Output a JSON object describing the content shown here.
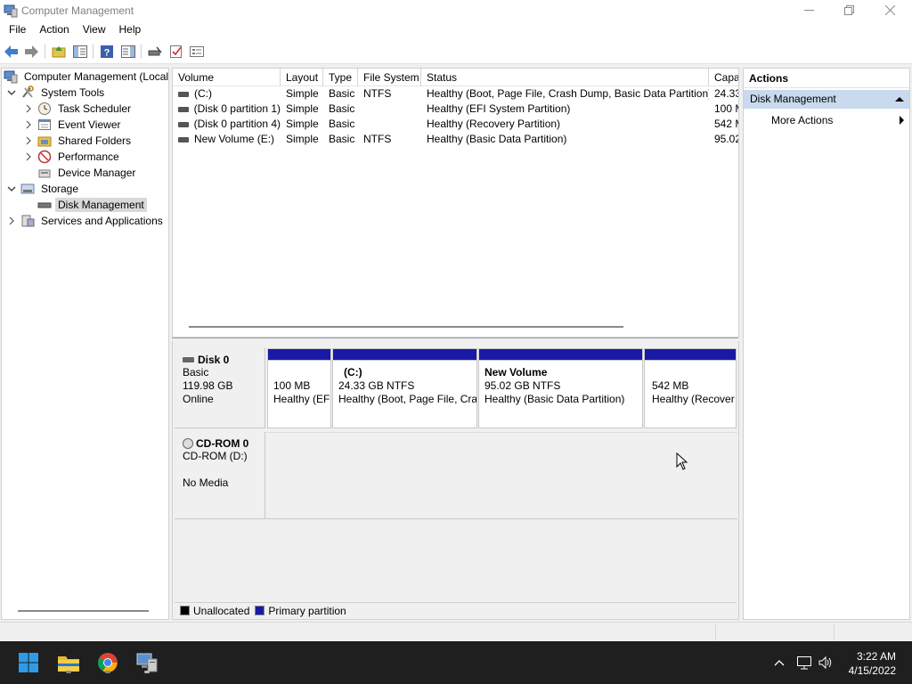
{
  "window": {
    "title": "Computer Management"
  },
  "menu": [
    "File",
    "Action",
    "View",
    "Help"
  ],
  "tree": {
    "root": "Computer Management (Local",
    "system_tools": "System Tools",
    "task_scheduler": "Task Scheduler",
    "event_viewer": "Event Viewer",
    "shared_folders": "Shared Folders",
    "performance": "Performance",
    "device_manager": "Device Manager",
    "storage": "Storage",
    "disk_management": "Disk Management",
    "services": "Services and Applications"
  },
  "volumes": {
    "columns": [
      "Volume",
      "Layout",
      "Type",
      "File System",
      "Status",
      "Capa"
    ],
    "rows": [
      {
        "volume": " (C:)",
        "layout": "Simple",
        "type": "Basic",
        "fs": "NTFS",
        "status": "Healthy (Boot, Page File, Crash Dump, Basic Data Partition)",
        "capacity": "24.33"
      },
      {
        "volume": "(Disk 0 partition 1)",
        "layout": "Simple",
        "type": "Basic",
        "fs": "",
        "status": "Healthy (EFI System Partition)",
        "capacity": "100 M"
      },
      {
        "volume": "(Disk 0 partition 4)",
        "layout": "Simple",
        "type": "Basic",
        "fs": "",
        "status": "Healthy (Recovery Partition)",
        "capacity": "542 M"
      },
      {
        "volume": "New Volume (E:)",
        "layout": "Simple",
        "type": "Basic",
        "fs": "NTFS",
        "status": "Healthy (Basic Data Partition)",
        "capacity": "95.02"
      }
    ]
  },
  "disk0": {
    "name": "Disk 0",
    "type": "Basic",
    "size": "119.98 GB",
    "state": "Online",
    "partitions": [
      {
        "title": "",
        "size": "100 MB",
        "status": "Healthy (EF"
      },
      {
        "title": "(C:)",
        "size": "24.33 GB NTFS",
        "status": "Healthy (Boot, Page File, Cra"
      },
      {
        "title": "New Volume",
        "size": "95.02 GB NTFS",
        "status": "Healthy (Basic Data Partition)"
      },
      {
        "title": "",
        "size": "542 MB",
        "status": "Healthy (Recover"
      }
    ]
  },
  "cdrom0": {
    "name": "CD-ROM 0",
    "drive": "CD-ROM (D:)",
    "media": "No Media"
  },
  "legend": {
    "unallocated": "Unallocated",
    "primary": "Primary partition",
    "unallocated_color": "#000000",
    "primary_color": "#1a19a6"
  },
  "actions": {
    "header": "Actions",
    "section": "Disk Management",
    "more": "More Actions"
  },
  "taskbar": {
    "time": "3:22 AM",
    "date": "4/15/2022"
  }
}
